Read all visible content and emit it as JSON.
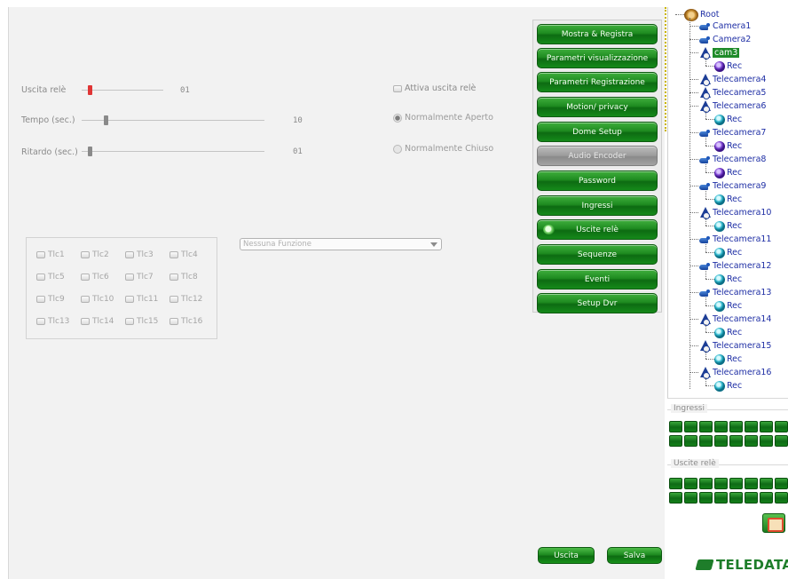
{
  "relay_settings": {
    "uscita_rele": {
      "label": "Uscita relè",
      "value": "01",
      "level": 0.0
    },
    "tempo": {
      "label": "Tempo (sec.)",
      "value": "10",
      "level": 0.1
    },
    "ritardo": {
      "label": "Ritardo (sec.)",
      "value": "01",
      "level": 0.0
    },
    "attiva_label": "Attiva uscita relè",
    "mode_open": "Normalmente Aperto",
    "mode_closed": "Normalmente Chiuso",
    "selected_mode": "open"
  },
  "tlc": [
    "Tlc1",
    "Tlc2",
    "Tlc3",
    "Tlc4",
    "Tlc5",
    "Tlc6",
    "Tlc7",
    "Tlc8",
    "Tlc9",
    "Tlc10",
    "Tlc11",
    "Tlc12",
    "Tlc13",
    "Tlc14",
    "Tlc15",
    "Tlc16"
  ],
  "function_select": {
    "value": "Nessuna Funzione"
  },
  "menu": [
    {
      "label": "Mostra & Registra",
      "state": "normal"
    },
    {
      "label": "Parametri visualizzazione",
      "state": "normal"
    },
    {
      "label": "Parametri Registrazione",
      "state": "normal"
    },
    {
      "label": "Motion/ privacy",
      "state": "normal"
    },
    {
      "label": "Dome Setup",
      "state": "normal"
    },
    {
      "label": "Audio Encoder",
      "state": "disabled"
    },
    {
      "label": "Password",
      "state": "normal"
    },
    {
      "label": "Ingressi",
      "state": "normal"
    },
    {
      "label": "Uscite relè",
      "state": "active"
    },
    {
      "label": "Sequenze",
      "state": "normal"
    },
    {
      "label": "Eventi",
      "state": "normal"
    },
    {
      "label": "Setup Dvr",
      "state": "normal"
    }
  ],
  "buttons": {
    "exit": "Uscita",
    "save": "Salva"
  },
  "tree": {
    "root": "Root",
    "rec_label": "Rec",
    "cameras": [
      {
        "name": "Camera1",
        "icon": "camera-icon",
        "rec": false
      },
      {
        "name": "Camera2",
        "icon": "camera-icon",
        "rec": false
      },
      {
        "name": "cam3",
        "icon": "dome-icon",
        "rec": "purple",
        "selected": true
      },
      {
        "name": "Telecamera4",
        "icon": "dome-icon",
        "rec": false
      },
      {
        "name": "Telecamera5",
        "icon": "dome-icon",
        "rec": false
      },
      {
        "name": "Telecamera6",
        "icon": "dome-icon",
        "rec": "teal"
      },
      {
        "name": "Telecamera7",
        "icon": "camera-icon",
        "rec": "purple"
      },
      {
        "name": "Telecamera8",
        "icon": "camera-icon",
        "rec": "purple"
      },
      {
        "name": "Telecamera9",
        "icon": "camera-icon",
        "rec": "teal"
      },
      {
        "name": "Telecamera10",
        "icon": "dome-icon",
        "rec": "teal"
      },
      {
        "name": "Telecamera11",
        "icon": "camera-icon",
        "rec": "teal"
      },
      {
        "name": "Telecamera12",
        "icon": "camera-icon",
        "rec": "teal"
      },
      {
        "name": "Telecamera13",
        "icon": "camera-icon",
        "rec": "teal"
      },
      {
        "name": "Telecamera14",
        "icon": "dome-icon",
        "rec": "teal"
      },
      {
        "name": "Telecamera15",
        "icon": "dome-icon",
        "rec": "teal"
      },
      {
        "name": "Telecamera16",
        "icon": "dome-icon",
        "rec": "teal"
      }
    ]
  },
  "io": {
    "inputs_label": "Ingressi",
    "relays_label": "Uscite relè",
    "inputs_count": 16,
    "relays_count": 16
  },
  "logo": "TELEDATA",
  "colors": {
    "accent_green": "#1e8b20",
    "tree_text": "#1f2fa5",
    "panel_bg": "#f2f2f2"
  }
}
